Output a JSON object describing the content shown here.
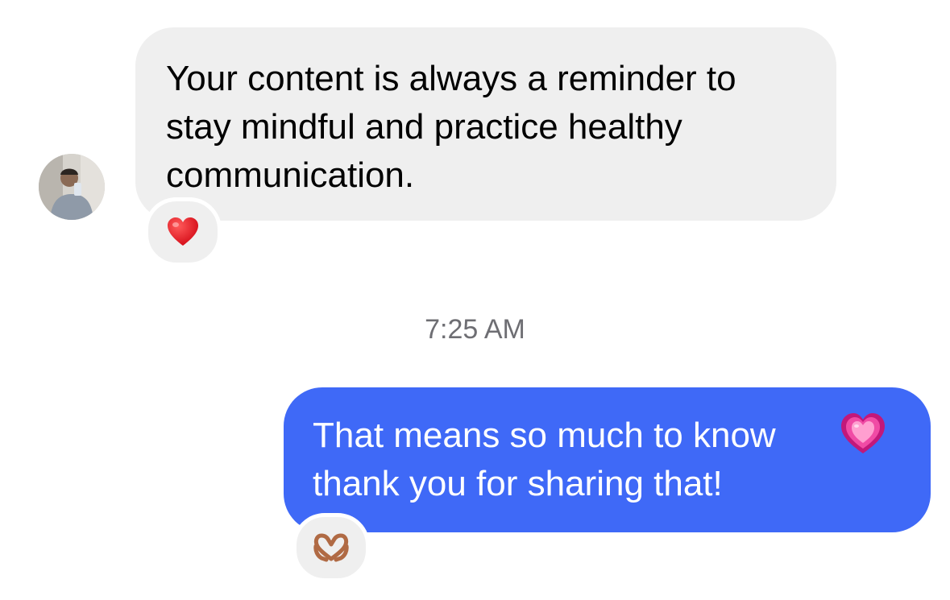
{
  "conversation": {
    "incoming": {
      "text": "Your content is always a reminder to\nstay mindful and practice healthy\ncommunication.",
      "reaction": "heart-emoji"
    },
    "timestamp": "7:25 AM",
    "outgoing": {
      "text": "That means so much to know\nthank you for sharing that!",
      "inline_emoji": "growing-heart-emoji",
      "reaction": "heart-hands-emoji"
    }
  },
  "colors": {
    "incoming_bubble": "#efefef",
    "outgoing_bubble": "#3f69f7",
    "timestamp": "#6e6e73"
  }
}
